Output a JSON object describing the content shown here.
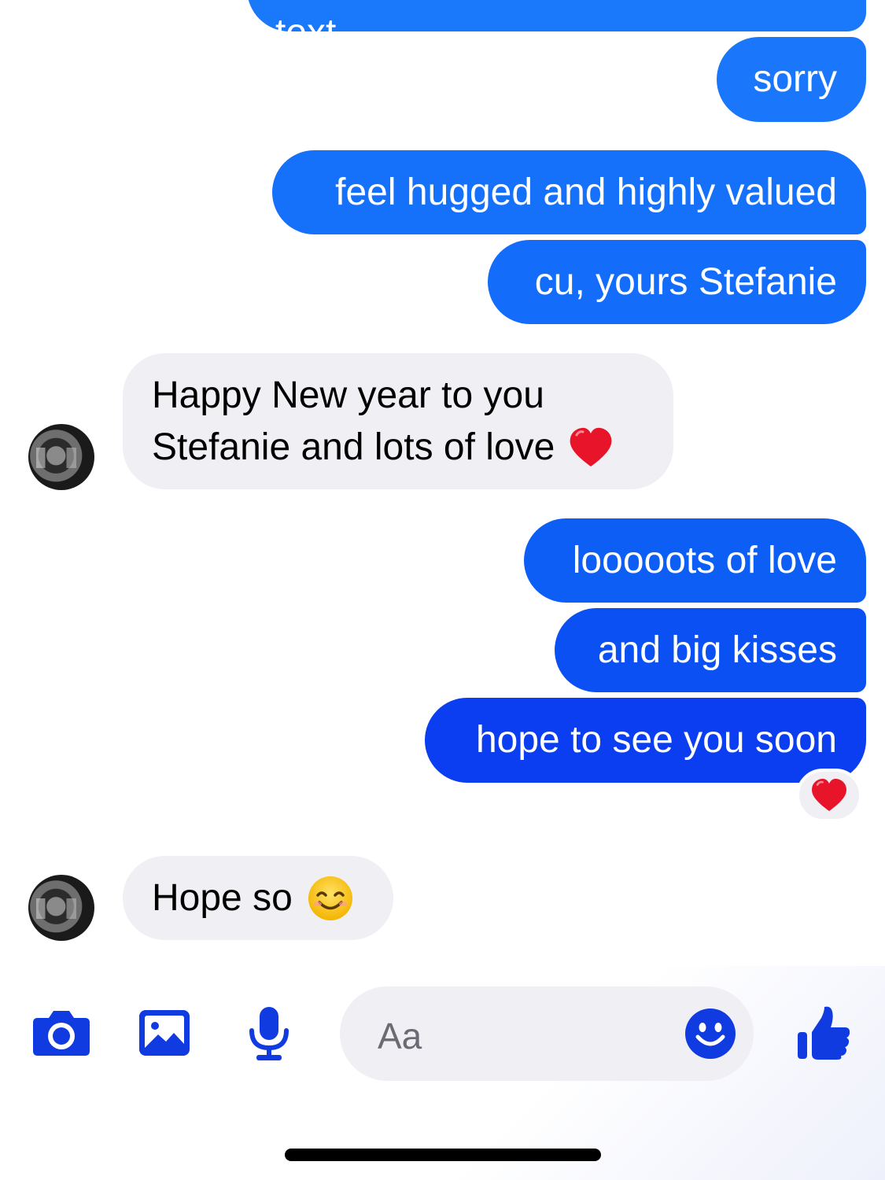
{
  "messages": {
    "partial_top": "text",
    "m1": "sorry",
    "m2": "feel hugged and highly valued",
    "m3": "cu, yours Stefanie",
    "m4_line1": "Happy New year to you",
    "m4_line2": "Stefanie and lots of love",
    "m5": "looooots of love",
    "m6": "and big kisses",
    "m7": "hope to see you soon",
    "m8": "Hope so"
  },
  "reaction": {
    "icon": "red-heart-icon"
  },
  "composer": {
    "placeholder": "Aa",
    "icons": [
      "camera-icon",
      "photo-icon",
      "microphone-icon",
      "emoji-icon",
      "thumbs-up-icon"
    ]
  },
  "colors": {
    "outgoing_light": "#1772fa",
    "outgoing_mid": "#0a5cf5",
    "outgoing_dark": "#0a3ff0",
    "incoming": "#f0f0f4",
    "accent": "#0f3be0"
  }
}
